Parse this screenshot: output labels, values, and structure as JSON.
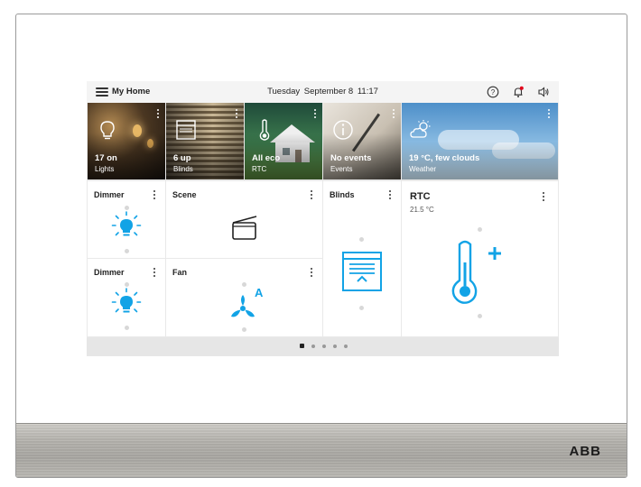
{
  "device": {
    "brand": "ABB"
  },
  "header": {
    "title": "My Home",
    "day": "Tuesday",
    "date": "September 8",
    "time": "11:17",
    "icons": [
      "help-icon",
      "notification-bell-icon",
      "volume-icon"
    ],
    "notification_badge_color": "#e2001a"
  },
  "summary_tiles": [
    {
      "title": "17 on",
      "subtitle": "Lights",
      "icon": "bulb-icon"
    },
    {
      "title": "6 up",
      "subtitle": "Blinds",
      "icon": "blinds-icon"
    },
    {
      "title": "All eco",
      "subtitle": "RTC",
      "icon": "thermometer-icon"
    },
    {
      "title": "No events",
      "subtitle": "Events",
      "icon": "info-icon"
    },
    {
      "title": "19 °C, few clouds",
      "subtitle": "Weather",
      "icon": "partly-cloudy-icon"
    }
  ],
  "control_tiles": {
    "dimmer_1": {
      "title": "Dimmer",
      "icon": "bulb-icon"
    },
    "scene": {
      "title": "Scene",
      "icon": "scene-icon"
    },
    "blinds": {
      "title": "Blinds",
      "icon": "blinds-icon"
    },
    "rtc": {
      "title": "RTC",
      "temperature": "21.5 °C",
      "icon": "thermometer-plus-icon"
    },
    "dimmer_2": {
      "title": "Dimmer",
      "icon": "bulb-icon"
    },
    "fan": {
      "title": "Fan",
      "mode": "A",
      "icon": "fan-icon"
    }
  },
  "pager": {
    "page_count": 5,
    "current_page": 1
  },
  "colors": {
    "accent": "#12a3e6",
    "screen_bg": "#e9e9e9"
  }
}
